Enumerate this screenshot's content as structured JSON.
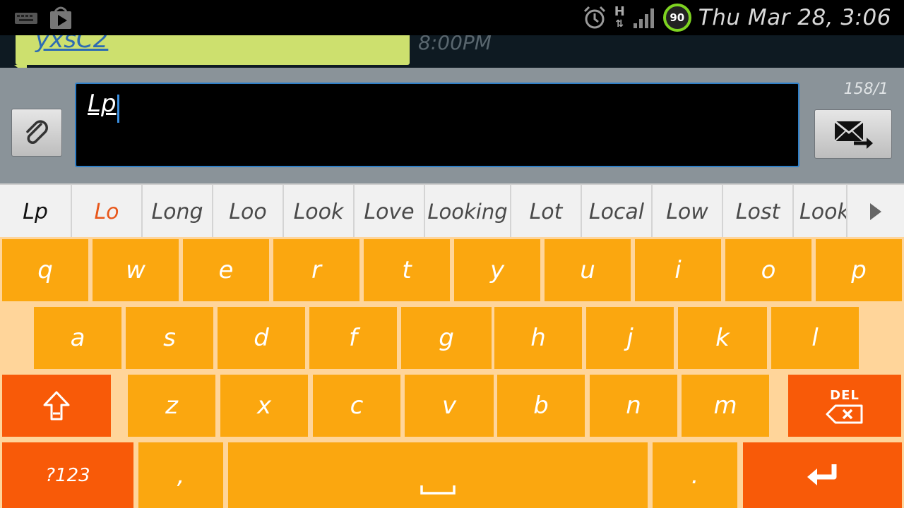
{
  "status_bar": {
    "time": "Thu Mar 28, 3:06",
    "battery": "90",
    "network": "H",
    "icons": [
      "keyboard-icon",
      "play-store-icon",
      "alarm-icon",
      "signal-icon"
    ]
  },
  "conversation": {
    "link_text": "yxsC2",
    "time": "8:00PM"
  },
  "compose": {
    "text": "Lp",
    "counter": "158/1"
  },
  "suggestions": [
    "Lp",
    "Lo",
    "Long",
    "Loo",
    "Look",
    "Love",
    "Looking",
    "Lot",
    "Local",
    "Low",
    "Lost",
    "Look"
  ],
  "keyboard": {
    "row1": [
      "q",
      "w",
      "e",
      "r",
      "t",
      "y",
      "u",
      "i",
      "o",
      "p"
    ],
    "row2": [
      "a",
      "s",
      "d",
      "f",
      "g",
      "h",
      "j",
      "k",
      "l"
    ],
    "row3": [
      "z",
      "x",
      "c",
      "v",
      "b",
      "n",
      "m"
    ],
    "del_label": "DEL",
    "symbols_label": "?123",
    "comma": ",",
    "period": "."
  },
  "colors": {
    "key": "#fba70f",
    "function_key": "#f85a08",
    "keyboard_bg": "#ffd59a",
    "suggestion_highlight": "#e8571a"
  }
}
